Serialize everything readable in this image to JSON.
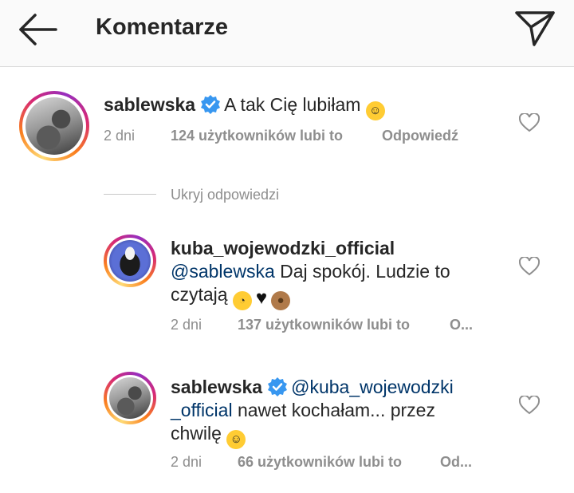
{
  "header": {
    "title": "Komentarze",
    "back_icon": "arrow-left-icon",
    "send_icon": "paper-plane-icon"
  },
  "colors": {
    "mention": "#003569",
    "verified": "#3897f0",
    "meta": "#8e8e8e",
    "heart": "#8e8e8e"
  },
  "comments": [
    {
      "username": "sablewska",
      "verified": true,
      "text": "A tak Cię lubiłam",
      "emoji": "yum-face",
      "time": "2 dni",
      "likes": "124 użytkowników lubi to",
      "reply_label": "Odpowiedź"
    }
  ],
  "hide_replies_label": "Ukryj odpowiedzi",
  "replies": [
    {
      "username": "kuba_wojewodzki_official",
      "verified": false,
      "mention": "@sablewska",
      "text_line1": " Daj spokój. Ludzie to",
      "text_line2": "czytają",
      "emojis": [
        "eye-roll-face",
        "black-heart",
        "see-no-evil-monkey"
      ],
      "time": "2 dni",
      "likes": "137 użytkowników lubi to",
      "reply_label": "O..."
    },
    {
      "username": "sablewska",
      "verified": true,
      "mention_line1": "@kuba_wojewodzki",
      "mention_line2": "_official",
      "text_line2": " nawet kochałam... przez",
      "text_line3": "chwilę",
      "emoji": "yum-face",
      "time": "2 dni",
      "likes": "66 użytkowników lubi to",
      "reply_label": "Od..."
    }
  ]
}
